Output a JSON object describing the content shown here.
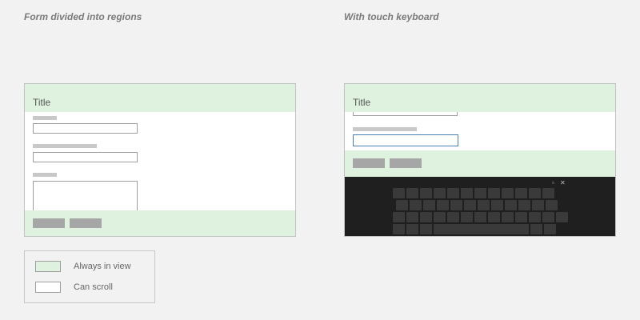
{
  "captions": {
    "left": "Form divided into regions",
    "right": "With touch keyboard"
  },
  "form": {
    "title": "Title"
  },
  "keyboard": {
    "undock_icon": "undock-icon",
    "close_icon": "close-icon",
    "undock_glyph": "▫",
    "close_glyph": "✕"
  },
  "legend": {
    "always_in_view": "Always in view",
    "can_scroll": "Can scroll"
  },
  "colors": {
    "always_in_view": "#dff1df",
    "can_scroll": "#ffffff",
    "background": "#f2f2f2",
    "keyboard": "#1f1f1f",
    "focused_field": "#4a7fb3"
  }
}
